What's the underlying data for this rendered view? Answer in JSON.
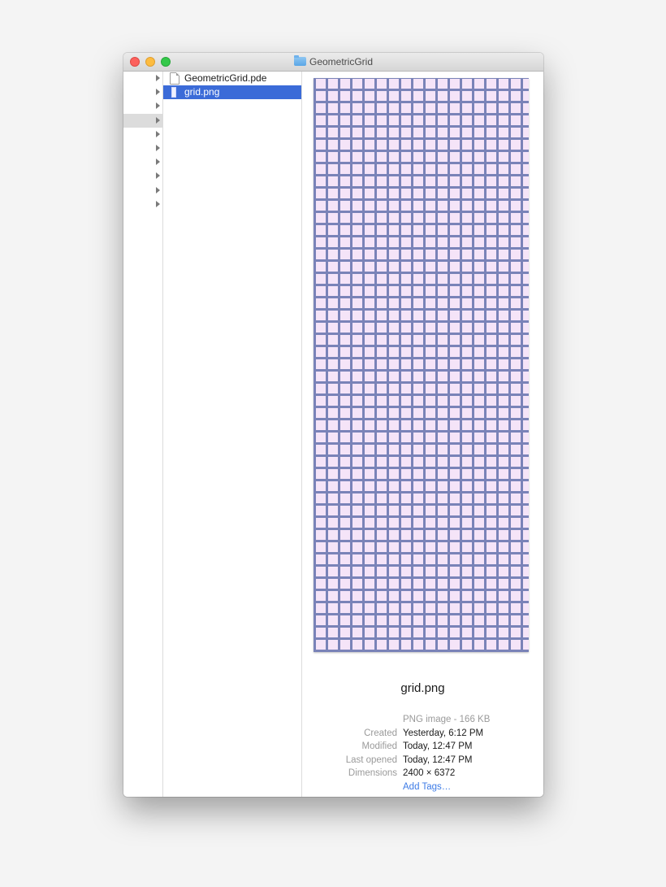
{
  "window": {
    "title": "GeometricGrid"
  },
  "column1": {
    "row_count": 10,
    "selected_index": 3
  },
  "files": [
    {
      "name": "GeometricGrid.pde",
      "icon": "document-icon",
      "selected": false
    },
    {
      "name": "grid.png",
      "icon": "image-file-icon",
      "selected": true
    }
  ],
  "preview": {
    "filename": "grid.png",
    "type": "PNG image - 166 KB",
    "rows": [
      {
        "key": "Created",
        "value": "Yesterday, 6:12 PM"
      },
      {
        "key": "Modified",
        "value": "Today, 12:47 PM"
      },
      {
        "key": "Last opened",
        "value": "Today, 12:47 PM"
      },
      {
        "key": "Dimensions",
        "value": "2400 × 6372"
      }
    ],
    "add_tags": "Add Tags…"
  },
  "colors": {
    "selection": "#3b6bd8",
    "grid_line": "#7a83b8",
    "grid_cell": "#f5e4f8",
    "link": "#3d7be6"
  }
}
